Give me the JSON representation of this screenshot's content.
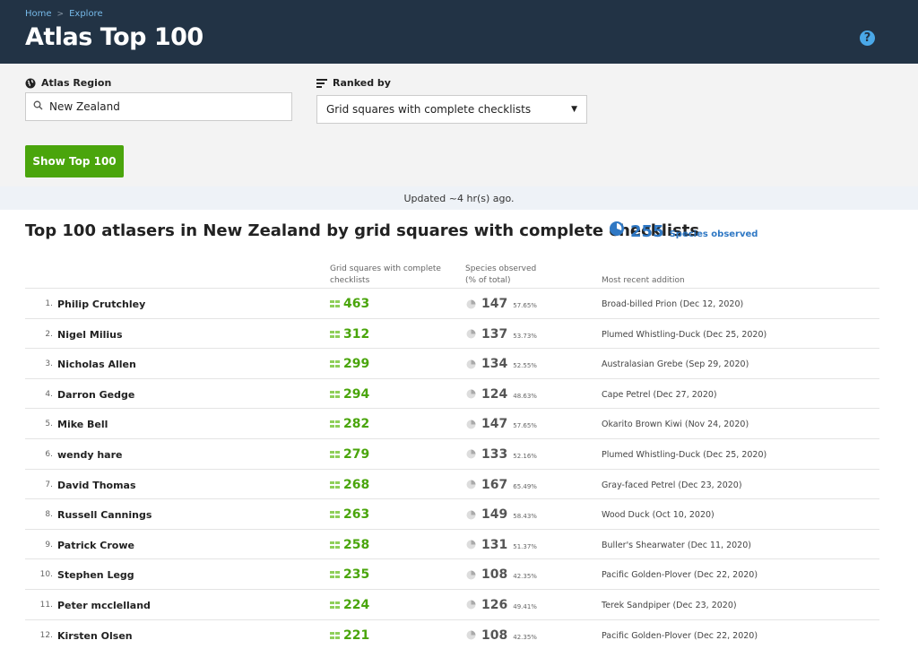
{
  "breadcrumb": {
    "home": "Home",
    "sep": ">",
    "explore": "Explore"
  },
  "title": "Atlas Top 100",
  "help_icon": "?",
  "filters": {
    "region_label": "Atlas Region",
    "region_value": "New Zealand",
    "ranked_label": "Ranked by",
    "ranked_value": "Grid squares with complete checklists",
    "button": "Show Top 100"
  },
  "updated": "Updated ~4 hr(s) ago.",
  "section": {
    "title": "Top 100 atlasers in New Zealand by grid squares with complete checklists",
    "species_total": "255",
    "species_label": "Species observed"
  },
  "columns": {
    "grid_l1": "Grid squares with complete",
    "grid_l2": "checklists",
    "sp_l1": "Species observed",
    "sp_l2": "(% of total)",
    "recent": "Most recent addition"
  },
  "rows": [
    {
      "rank": "1.",
      "name": "Philip Crutchley",
      "grid": "463",
      "species": "147",
      "pct": "57.65%",
      "recent": "Broad-billed Prion (Dec 12, 2020)"
    },
    {
      "rank": "2.",
      "name": "Nigel Milius",
      "grid": "312",
      "species": "137",
      "pct": "53.73%",
      "recent": "Plumed Whistling-Duck (Dec 25, 2020)"
    },
    {
      "rank": "3.",
      "name": "Nicholas Allen",
      "grid": "299",
      "species": "134",
      "pct": "52.55%",
      "recent": "Australasian Grebe (Sep 29, 2020)"
    },
    {
      "rank": "4.",
      "name": "Darron Gedge",
      "grid": "294",
      "species": "124",
      "pct": "48.63%",
      "recent": "Cape Petrel (Dec 27, 2020)"
    },
    {
      "rank": "5.",
      "name": "Mike Bell",
      "grid": "282",
      "species": "147",
      "pct": "57.65%",
      "recent": "Okarito Brown Kiwi (Nov 24, 2020)"
    },
    {
      "rank": "6.",
      "name": "wendy hare",
      "grid": "279",
      "species": "133",
      "pct": "52.16%",
      "recent": "Plumed Whistling-Duck (Dec 25, 2020)"
    },
    {
      "rank": "7.",
      "name": "David Thomas",
      "grid": "268",
      "species": "167",
      "pct": "65.49%",
      "recent": "Gray-faced Petrel (Dec 23, 2020)"
    },
    {
      "rank": "8.",
      "name": "Russell Cannings",
      "grid": "263",
      "species": "149",
      "pct": "58.43%",
      "recent": "Wood Duck (Oct 10, 2020)"
    },
    {
      "rank": "9.",
      "name": "Patrick Crowe",
      "grid": "258",
      "species": "131",
      "pct": "51.37%",
      "recent": "Buller's Shearwater (Dec 11, 2020)"
    },
    {
      "rank": "10.",
      "name": "Stephen Legg",
      "grid": "235",
      "species": "108",
      "pct": "42.35%",
      "recent": "Pacific Golden-Plover (Dec 22, 2020)"
    },
    {
      "rank": "11.",
      "name": "Peter mcclelland",
      "grid": "224",
      "species": "126",
      "pct": "49.41%",
      "recent": "Terek Sandpiper (Dec 23, 2020)"
    },
    {
      "rank": "12.",
      "name": "Kirsten Olsen",
      "grid": "221",
      "species": "108",
      "pct": "42.35%",
      "recent": "Pacific Golden-Plover (Dec 22, 2020)"
    }
  ]
}
